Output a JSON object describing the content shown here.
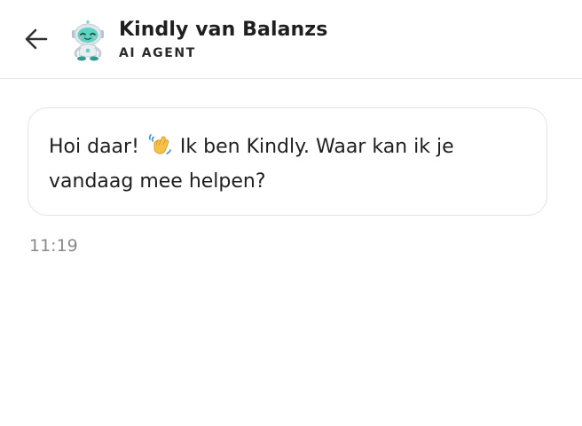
{
  "header": {
    "back_icon": "arrow-left-icon",
    "avatar_icon": "robot-avatar-icon",
    "agent_name": "Kindly van Balanzs",
    "agent_role": "AI AGENT"
  },
  "conversation": {
    "messages": [
      {
        "sender": "agent",
        "text_before_emoji": "Hoi daar!",
        "emoji": "waving-hand-icon",
        "text_after_emoji": "Ik ben Kindly. Waar kan ik je vandaag mee helpen?",
        "time": "11:19"
      }
    ]
  },
  "colors": {
    "text": "#1f1f1f",
    "muted": "#8a8a8a",
    "border": "#e3e3e3",
    "avatar_teal": "#5fd3c2"
  }
}
